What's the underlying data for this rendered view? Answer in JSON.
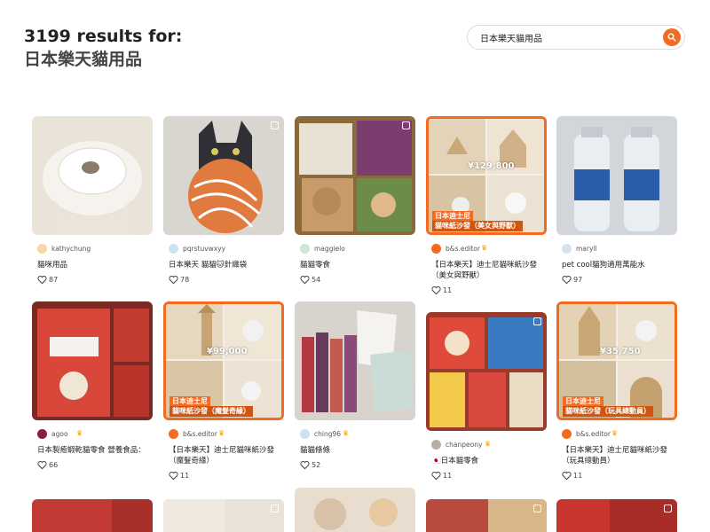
{
  "header": {
    "results_line": "3199 results for:",
    "query_line": "日本樂天貓用品"
  },
  "search": {
    "value": "日本樂天貓用品"
  },
  "colors": {
    "accent": "#f26b21"
  },
  "cards": [
    {
      "user": "kathychung",
      "caption": "貓咪用品",
      "likes": "87",
      "has_crown": false
    },
    {
      "user": "pqrstuvwxyy",
      "caption": "日本樂天 貓貓🐱針織袋",
      "likes": "78",
      "has_crown": false
    },
    {
      "user": "maggielo",
      "caption": "貓貓零食",
      "likes": "54",
      "has_crown": false
    },
    {
      "user": "b&s.editor",
      "caption": "【日本樂天】迪士尼貓咪紙沙發（美女與野獸）",
      "likes": "11",
      "has_crown": true,
      "price": "¥129,800",
      "tag": "日本迪士尼",
      "tag2": "貓咪紙沙發（美女與野獸）"
    },
    {
      "user": "maryll",
      "caption": "pet cool貓狗適用萬能水",
      "likes": "97",
      "has_crown": false
    },
    {
      "user": "agoo",
      "caption": "日本製癒蝦乾貓零食 營養食品：",
      "likes": "66",
      "has_crown": true
    },
    {
      "user": "b&s.editor",
      "caption": "【日本樂天】迪士尼貓咪紙沙發（魔髮奇緣）",
      "likes": "11",
      "has_crown": true,
      "price": "¥99,000",
      "tag": "日本迪士尼",
      "tag2": "貓咪紙沙發（魔髮奇緣）"
    },
    {
      "user": "ching96",
      "caption": "貓貓條條",
      "likes": "52",
      "has_crown": true
    },
    {
      "user": "chanpeony",
      "caption": "🇯🇵日本貓零食",
      "likes": "11",
      "has_crown": true
    },
    {
      "user": "b&s.editor",
      "caption": "【日本樂天】迪士尼貓咪紙沙發（玩具總動員）",
      "likes": "11",
      "has_crown": true,
      "price": "¥35,750",
      "tag": "日本迪士尼",
      "tag2": "貓咪紙沙發（玩具總動員）"
    }
  ]
}
